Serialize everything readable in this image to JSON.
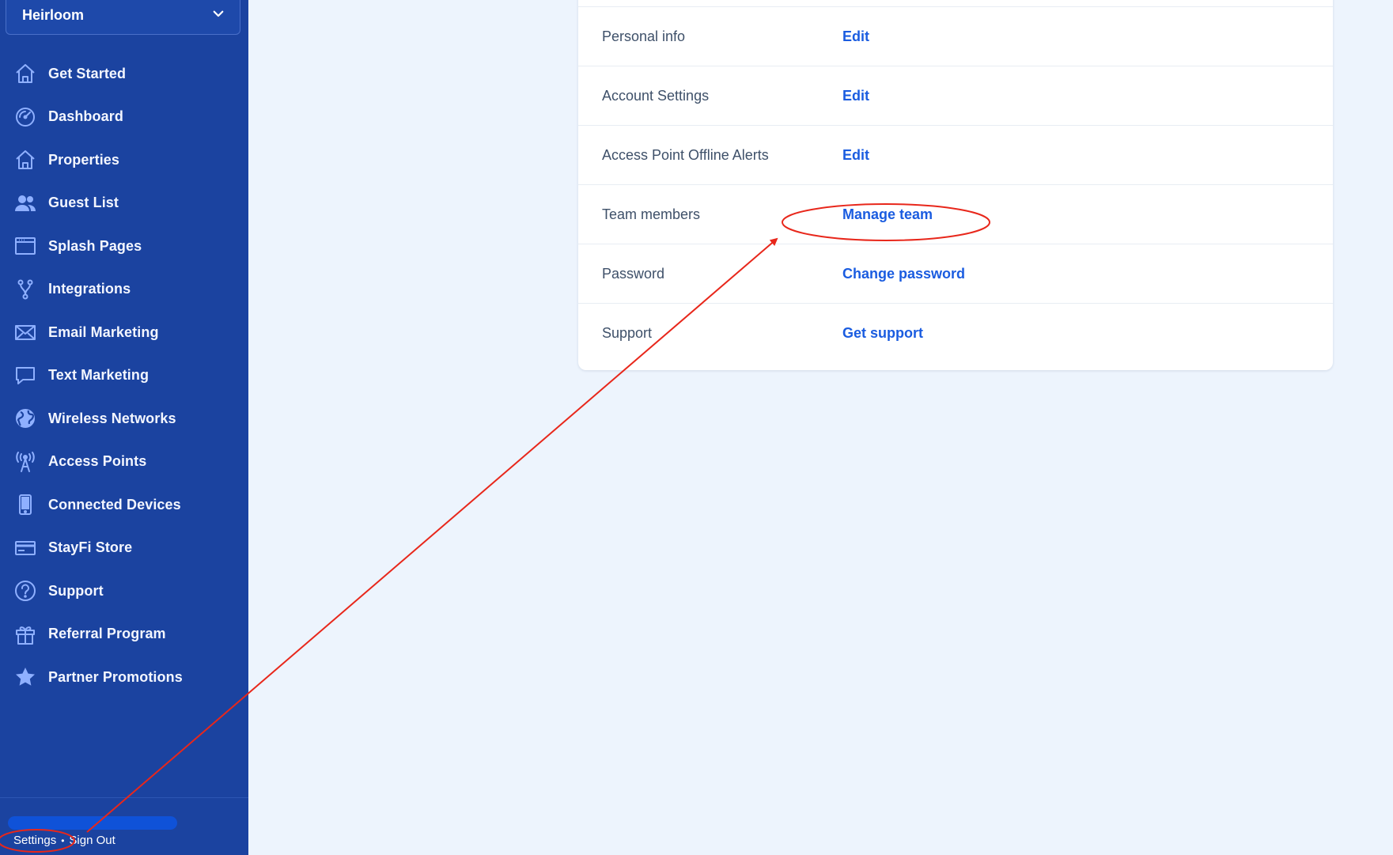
{
  "sidebar": {
    "org_select": {
      "value": "Heirloom",
      "icon": "chevron-down-icon"
    },
    "items": [
      {
        "label": "Get Started",
        "icon": "home-icon"
      },
      {
        "label": "Dashboard",
        "icon": "speedometer-icon"
      },
      {
        "label": "Properties",
        "icon": "home-icon"
      },
      {
        "label": "Guest List",
        "icon": "users-icon"
      },
      {
        "label": "Splash Pages",
        "icon": "browser-window-icon"
      },
      {
        "label": "Integrations",
        "icon": "fork-icon"
      },
      {
        "label": "Email Marketing",
        "icon": "envelope-icon"
      },
      {
        "label": "Text Marketing",
        "icon": "chat-bubble-icon"
      },
      {
        "label": "Wireless Networks",
        "icon": "globe-icon"
      },
      {
        "label": "Access Points",
        "icon": "antenna-icon"
      },
      {
        "label": "Connected Devices",
        "icon": "phone-icon"
      },
      {
        "label": "StayFi Store",
        "icon": "credit-card-icon"
      },
      {
        "label": "Support",
        "icon": "question-circle-icon"
      },
      {
        "label": "Referral Program",
        "icon": "gift-icon"
      },
      {
        "label": "Partner Promotions",
        "icon": "star-icon"
      }
    ],
    "footer": {
      "settings_label": "Settings",
      "separator": "•",
      "signout_label": "Sign Out"
    }
  },
  "settings_card": {
    "rows": [
      {
        "label": "Personal info",
        "action": "Edit"
      },
      {
        "label": "Account Settings",
        "action": "Edit"
      },
      {
        "label": "Access Point Offline Alerts",
        "action": "Edit"
      },
      {
        "label": "Team members",
        "action": "Manage team"
      },
      {
        "label": "Password",
        "action": "Change password"
      },
      {
        "label": "Support",
        "action": "Get support"
      }
    ]
  },
  "annotation": {
    "color": "#e8271b"
  }
}
